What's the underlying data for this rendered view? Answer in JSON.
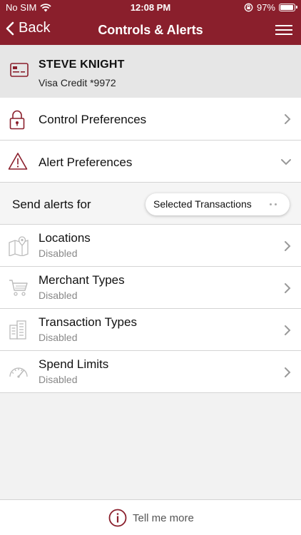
{
  "status": {
    "carrier": "No SIM",
    "time": "12:08 PM",
    "battery": "97%"
  },
  "nav": {
    "back_label": "Back",
    "title": "Controls & Alerts"
  },
  "card": {
    "holder": "STEVE KNIGHT",
    "description": "Visa Credit *9972"
  },
  "sections": {
    "control_preferences": "Control Preferences",
    "alert_preferences": "Alert Preferences"
  },
  "send_alerts": {
    "label": "Send alerts for",
    "selected": "Selected Transactions"
  },
  "alert_items": [
    {
      "label": "Locations",
      "status": "Disabled",
      "icon": "map-icon"
    },
    {
      "label": "Merchant Types",
      "status": "Disabled",
      "icon": "cart-icon"
    },
    {
      "label": "Transaction Types",
      "status": "Disabled",
      "icon": "buildings-icon"
    },
    {
      "label": "Spend Limits",
      "status": "Disabled",
      "icon": "gauge-icon"
    }
  ],
  "footer": {
    "label": "Tell me more"
  },
  "colors": {
    "brand": "#8a1f2c",
    "background": "#f2f2f2"
  }
}
